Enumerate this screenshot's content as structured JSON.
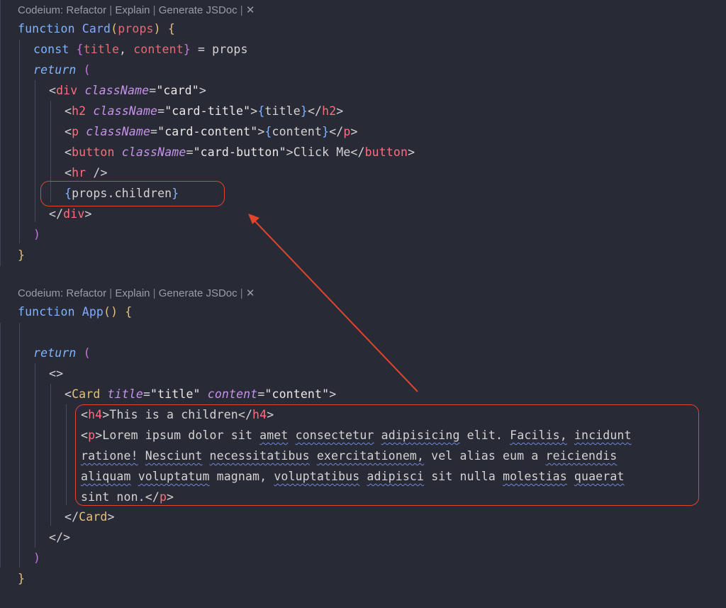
{
  "codelens": {
    "prefix": "Codeium: ",
    "refactor": "Refactor",
    "explain": "Explain",
    "jsdoc": "Generate JSDoc",
    "sep": " | ",
    "close": "✕"
  },
  "colors": {
    "background": "#282a36",
    "highlight": "#e0452e"
  },
  "code": {
    "card_fn": {
      "kw_function": "function",
      "name": "Card",
      "param": "props",
      "l2_const": "const",
      "l2_title": "title",
      "l2_content": "content",
      "l2_props": "props",
      "kw_return": "return",
      "div": "div",
      "className": "className",
      "card": "\"card\"",
      "h2": "h2",
      "card_title": "\"card-title\"",
      "title_var": "title",
      "p": "p",
      "card_content": "\"card-content\"",
      "content_var": "content",
      "button": "button",
      "card_button": "\"card-button\"",
      "click_me": "Click Me",
      "hr": "hr",
      "children_expr": "props.children"
    },
    "app_fn": {
      "kw_function": "function",
      "name": "App",
      "kw_return": "return",
      "Card": "Card",
      "title_attr": "title",
      "title_val": "\"title\"",
      "content_attr": "content",
      "content_val": "\"content\"",
      "h4": "h4",
      "h4_text": "This is a children",
      "p": "p",
      "lorem_words": {
        "w1": "Lorem ipsum dolor sit",
        "amet": "amet",
        "consectetur": "consectetur",
        "adipisicing": "adipisicing",
        "elit": "elit.",
        "facilis": "Facilis,",
        "incidunt": "incidunt",
        "ratione": "ratione!",
        "nesciunt": "Nesciunt",
        "necessitatibus": "necessitatibus",
        "exercitationem": "exercitationem,",
        "vel": "vel alias eum a",
        "reiciendis": "reiciendis",
        "aliquam": "aliquam",
        "voluptatum": "voluptatum",
        "magnam": "magnam,",
        "voluptatibus": "voluptatibus",
        "adipisci": "adipisci",
        "sit": "sit",
        "nulla": "nulla",
        "molestias": "molestias",
        "quaerat": "quaerat",
        "sint": "sint non."
      }
    }
  }
}
